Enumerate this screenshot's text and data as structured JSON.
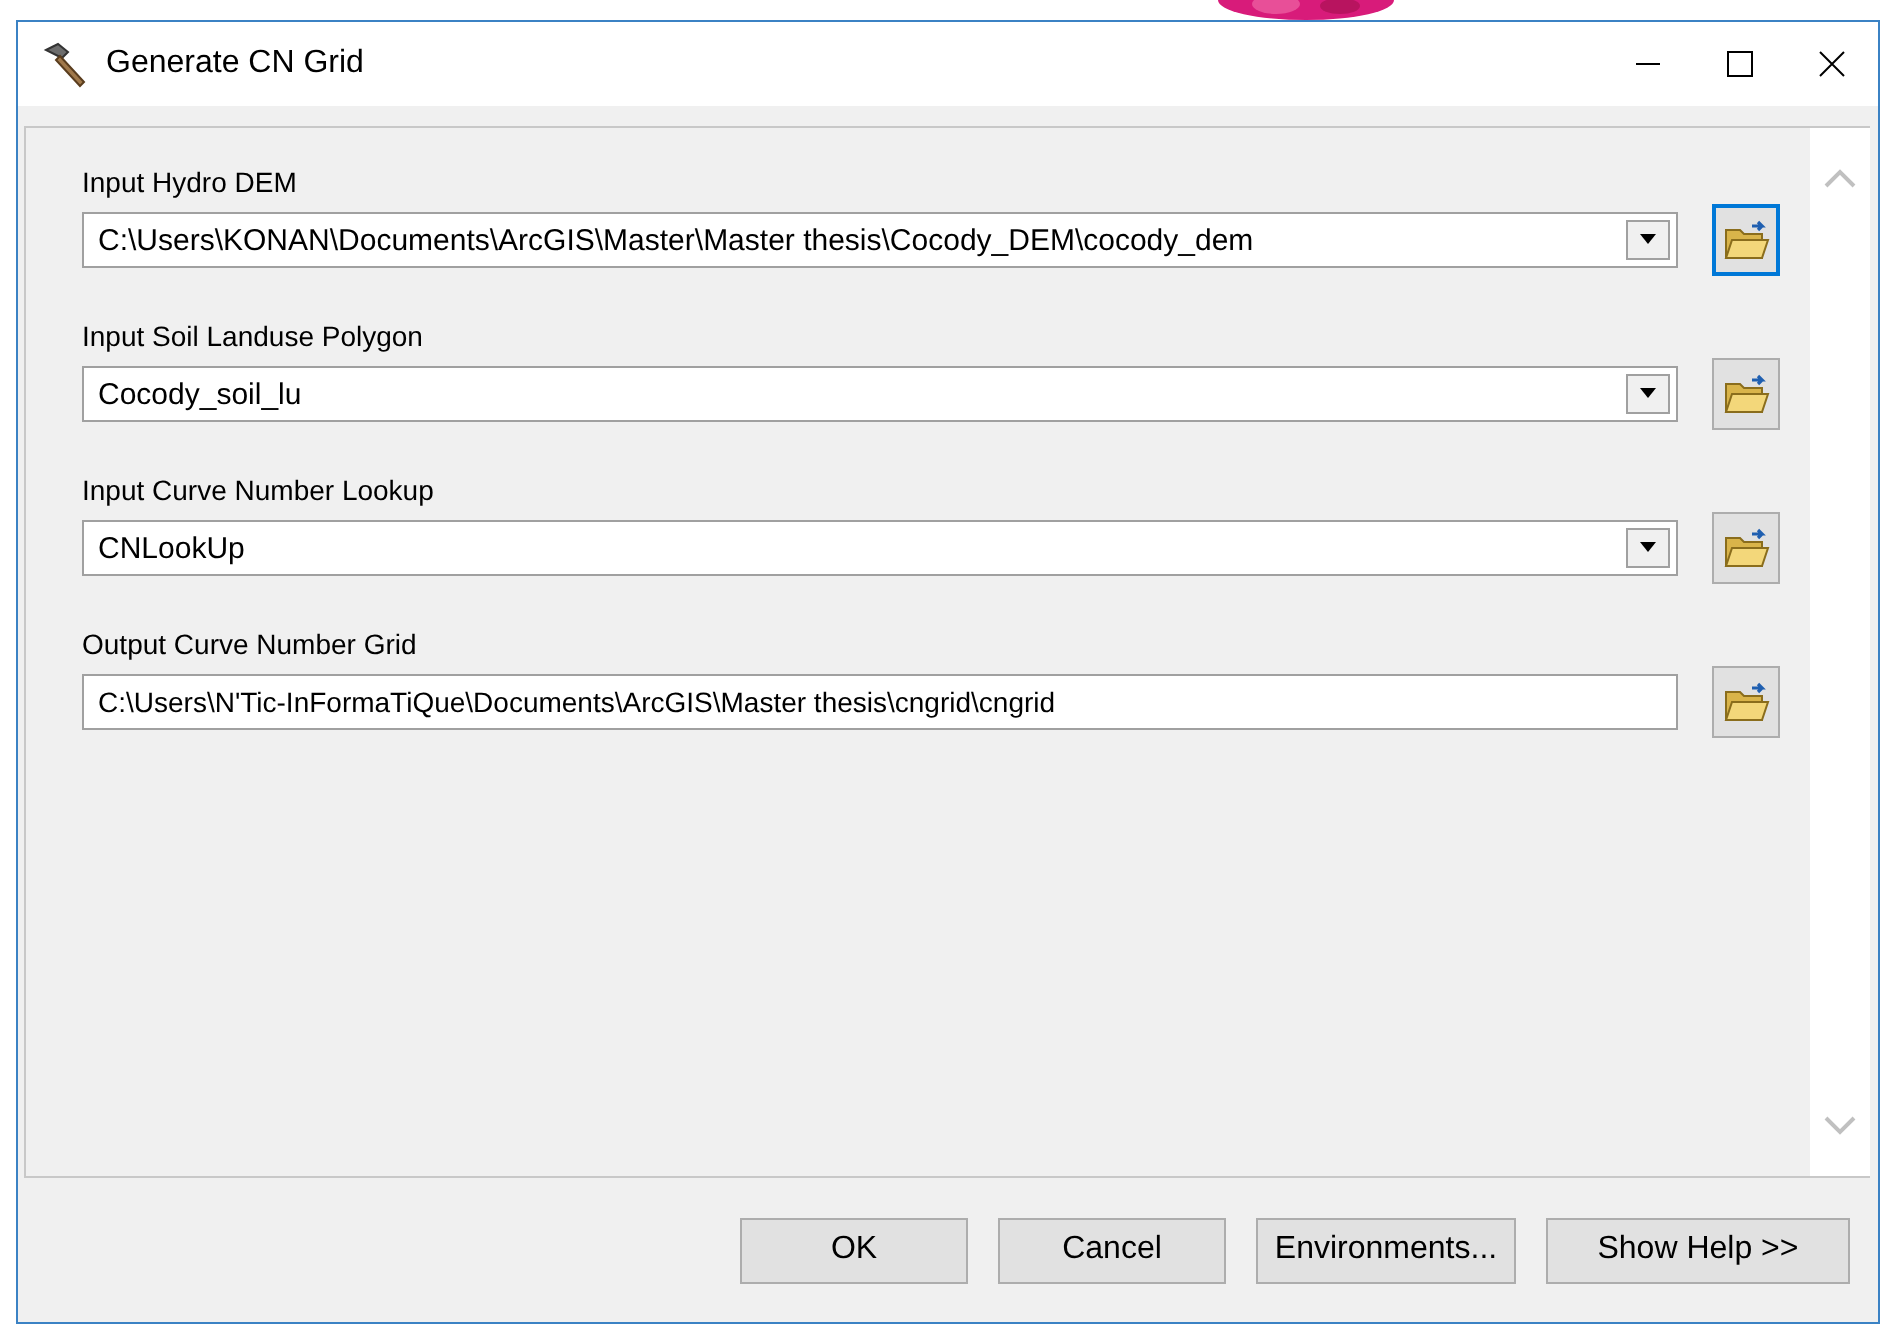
{
  "window": {
    "title": "Generate CN Grid"
  },
  "fields": [
    {
      "label": "Input Hydro DEM",
      "kind": "dropdown",
      "value": "C:\\Users\\KONAN\\Documents\\ArcGIS\\Master\\Master thesis\\Cocody_DEM\\cocody_dem",
      "browse_focused": true
    },
    {
      "label": "Input Soil Landuse Polygon",
      "kind": "dropdown",
      "value": "Cocody_soil_lu",
      "browse_focused": false
    },
    {
      "label": "Input Curve Number Lookup",
      "kind": "dropdown",
      "value": "CNLookUp",
      "browse_focused": false
    },
    {
      "label": "Output Curve Number Grid",
      "kind": "text",
      "value": "C:\\Users\\N'Tic-InFormaTiQue\\Documents\\ArcGIS\\Master thesis\\cngrid\\cngrid",
      "browse_focused": false
    }
  ],
  "buttons": [
    "OK",
    "Cancel",
    "Environments...",
    "Show Help >>"
  ]
}
